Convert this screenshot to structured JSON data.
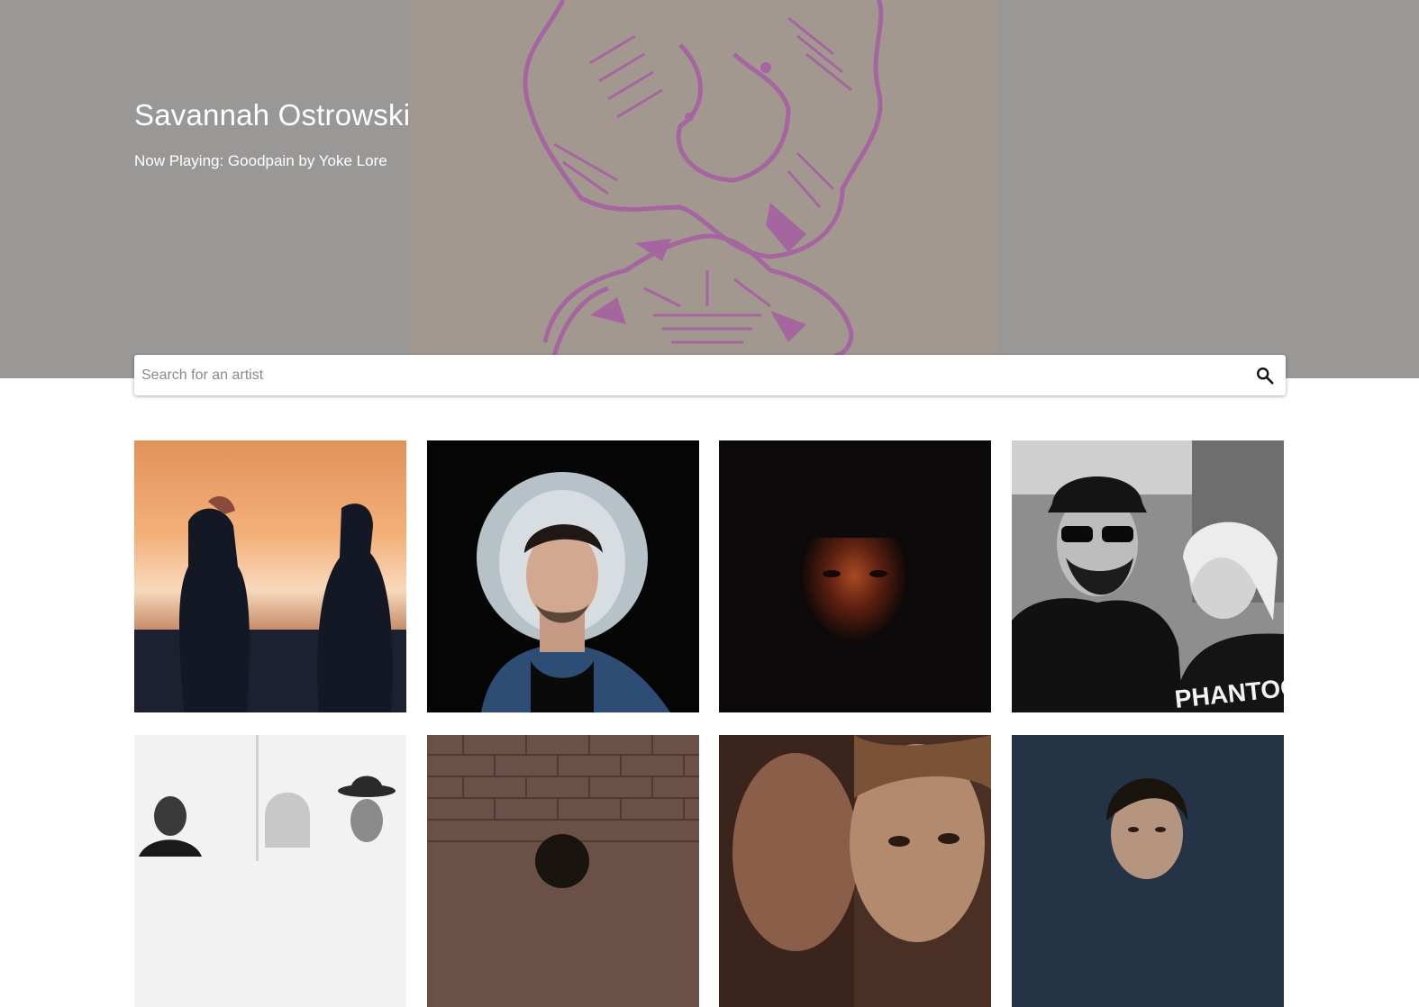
{
  "header": {
    "user_name": "Savannah Ostrowski",
    "now_playing": "Now Playing: Goodpain by Yoke Lore"
  },
  "search": {
    "placeholder": "Search for an artist",
    "value": "",
    "icon": "search-icon"
  },
  "tile_7_text": "PHANTOG",
  "colors": {
    "hero_bg": "#9a9896",
    "album_art_bg": "#a29890",
    "album_art_ink": "#a566a0",
    "page_bg": "#ffffff"
  }
}
